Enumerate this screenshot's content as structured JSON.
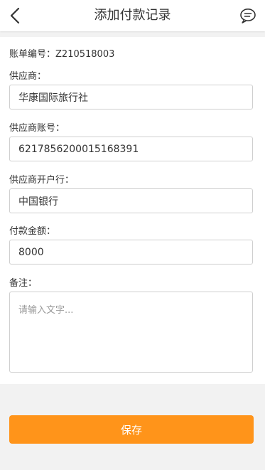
{
  "header": {
    "title": "添加付款记录",
    "back_icon": "chevron-left-icon",
    "chat_icon": "chat-bubble-icon"
  },
  "form": {
    "bill_no_label": "账单编号：",
    "bill_no_value": "Z210518003",
    "supplier_label": "供应商：",
    "supplier_value": "华康国际旅行社",
    "account_label": "供应商账号：",
    "account_value": "6217856200015168391",
    "bank_label": "供应商开户行：",
    "bank_value": "中国银行",
    "amount_label": "付款金额：",
    "amount_value": "8000",
    "remark_label": "备注：",
    "remark_placeholder": "请输入文字..."
  },
  "actions": {
    "save_label": "保存",
    "save_color": "#ff941a"
  }
}
